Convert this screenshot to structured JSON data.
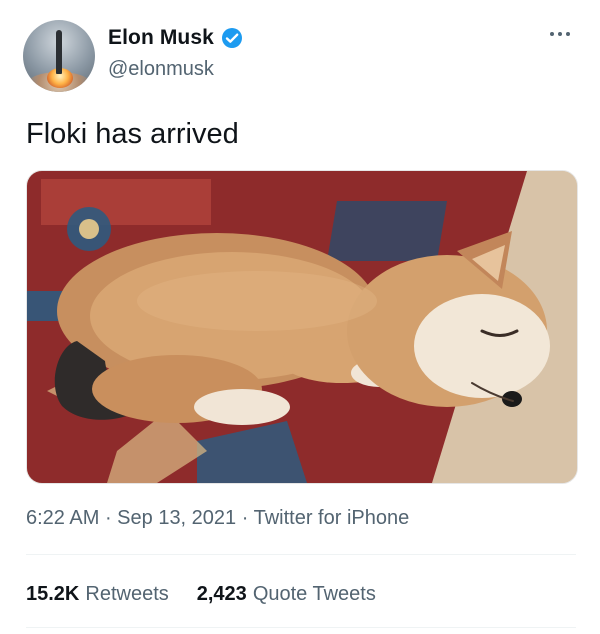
{
  "author": {
    "name": "Elon Musk",
    "handle": "@elonmusk",
    "verified": true
  },
  "tweet": {
    "text": "Floki has arrived",
    "time": "6:22 AM",
    "date": "Sep 13, 2021",
    "source": "Twitter for iPhone",
    "media_description": "puppy sleeping on rug"
  },
  "stats": {
    "retweets": {
      "count": "15.2K",
      "label": "Retweets"
    },
    "quote_tweets": {
      "count": "2,423",
      "label": "Quote Tweets"
    }
  },
  "colors": {
    "primary_text": "#0f1419",
    "secondary_text": "#536471",
    "verified_blue": "#1d9bf0",
    "divider": "#eff3f4"
  },
  "icons": {
    "verified": "verified-badge-icon",
    "more": "more-options-icon"
  }
}
